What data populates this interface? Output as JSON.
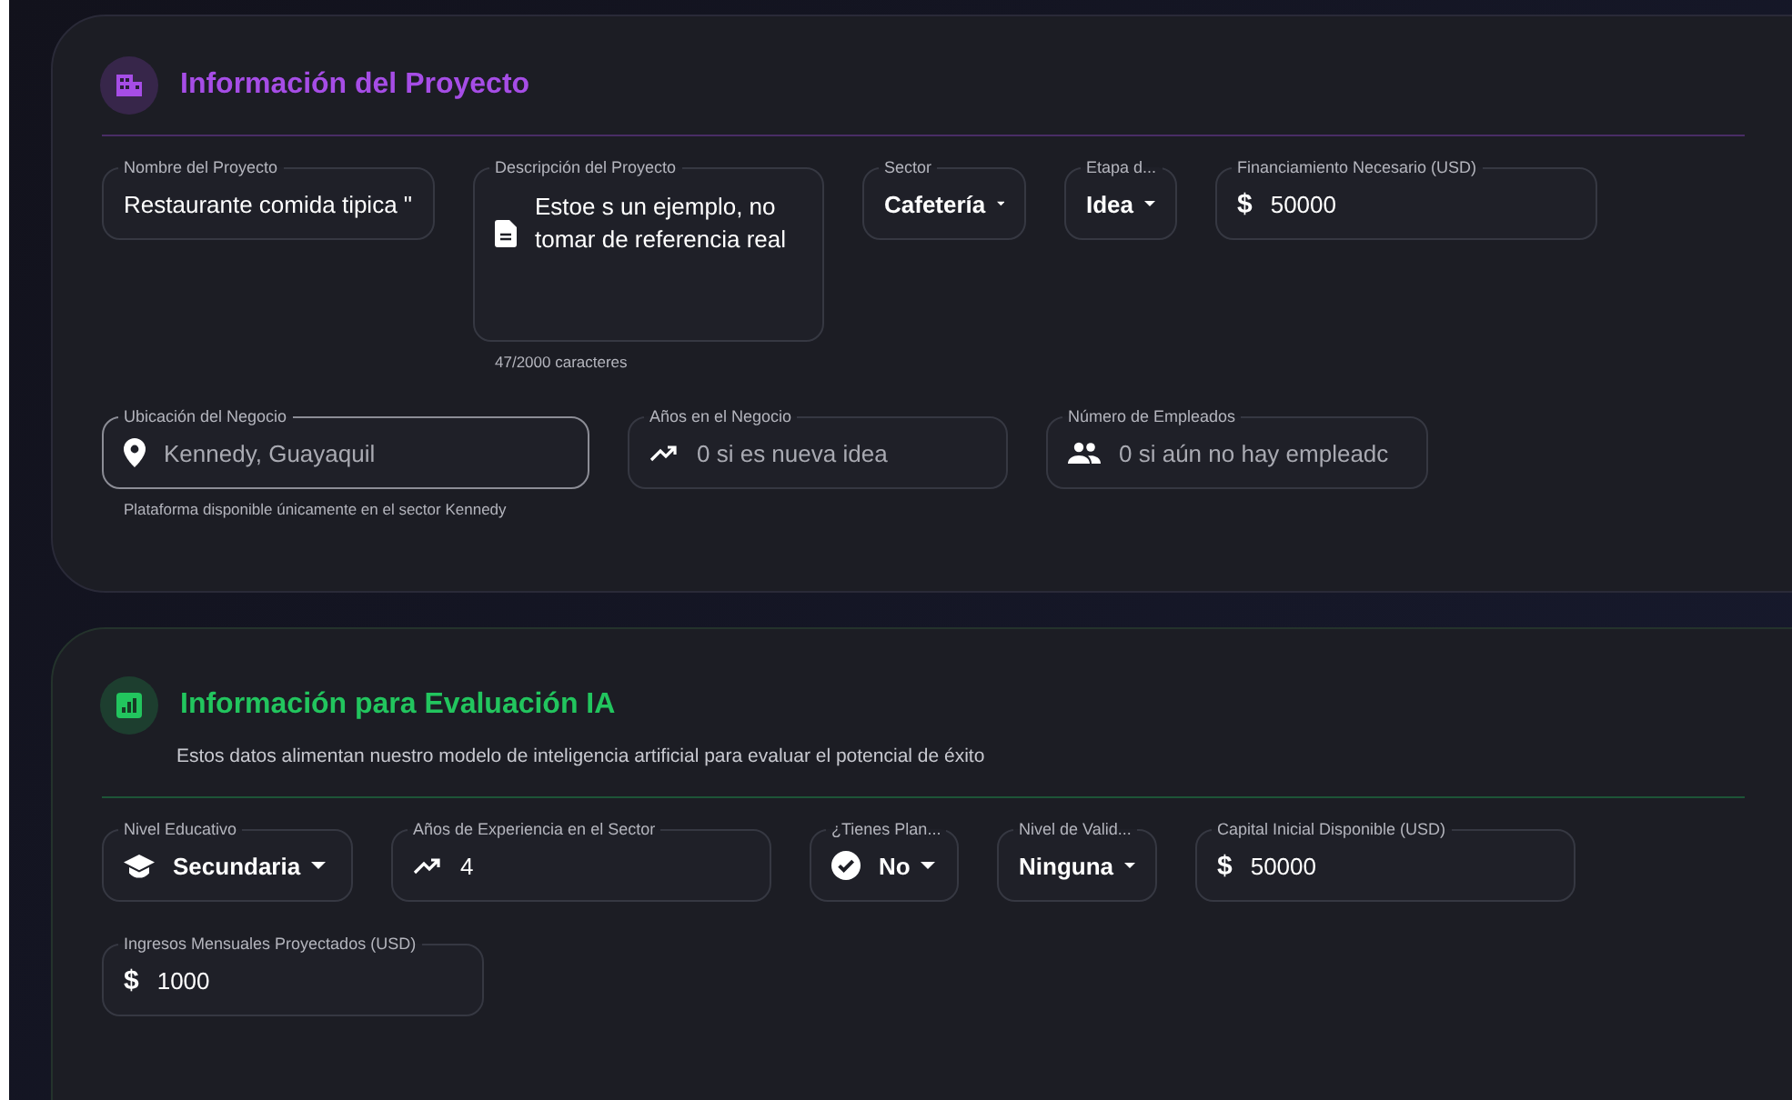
{
  "sections": [
    {
      "title": "Información del Proyecto",
      "rows": [
        {
          "fields": [
            {
              "kind": "text",
              "label": "Nombre del Proyecto",
              "value": "Restaurante comida tipica \""
            },
            {
              "kind": "textarea",
              "label": "Descripción del Proyecto",
              "value": "Estoe s un ejemplo, no tomar de referencia real",
              "helper": "47/2000 caracteres"
            },
            {
              "kind": "select",
              "label": "Sector",
              "value": "Cafetería"
            },
            {
              "kind": "select",
              "label": "Etapa d...",
              "value": "Idea"
            },
            {
              "kind": "money",
              "label": "Financiamiento Necesario (USD)",
              "prefix": "$",
              "value": "50000"
            }
          ]
        },
        {
          "fields": [
            {
              "kind": "location",
              "label": "Ubicación del Negocio",
              "placeholder": "Kennedy, Guayaquil",
              "focused": true,
              "helper": "Plataforma disponible únicamente en el sector Kennedy"
            },
            {
              "kind": "growth",
              "label": "Años en el Negocio",
              "placeholder": "0 si es nueva idea",
              "focused": false
            },
            {
              "kind": "people",
              "label": "Número de Empleados",
              "placeholder": "0 si aún no hay empleadc",
              "focused": false
            }
          ]
        }
      ]
    },
    {
      "title": "Información para Evaluación IA",
      "subtitle": "Estos datos alimentan nuestro modelo de inteligencia artificial para evaluar el potencial de éxito",
      "rows": [
        {
          "fields": [
            {
              "kind": "education-select",
              "label": "Nivel Educativo",
              "value": "Secundaria"
            },
            {
              "kind": "growth",
              "label": "Años de Experiencia en el Sector",
              "value": "4"
            },
            {
              "kind": "check-select",
              "label": "¿Tienes Plan...",
              "value": "No"
            },
            {
              "kind": "select",
              "label": "Nivel de Valid...",
              "value": "Ninguna"
            },
            {
              "kind": "money",
              "label": "Capital Inicial Disponible (USD)",
              "prefix": "$",
              "value": "50000"
            }
          ]
        },
        {
          "fields": [
            {
              "kind": "money",
              "label": "Ingresos Mensuales Proyectados (USD)",
              "prefix": "$",
              "value": "1000"
            }
          ]
        }
      ]
    }
  ]
}
